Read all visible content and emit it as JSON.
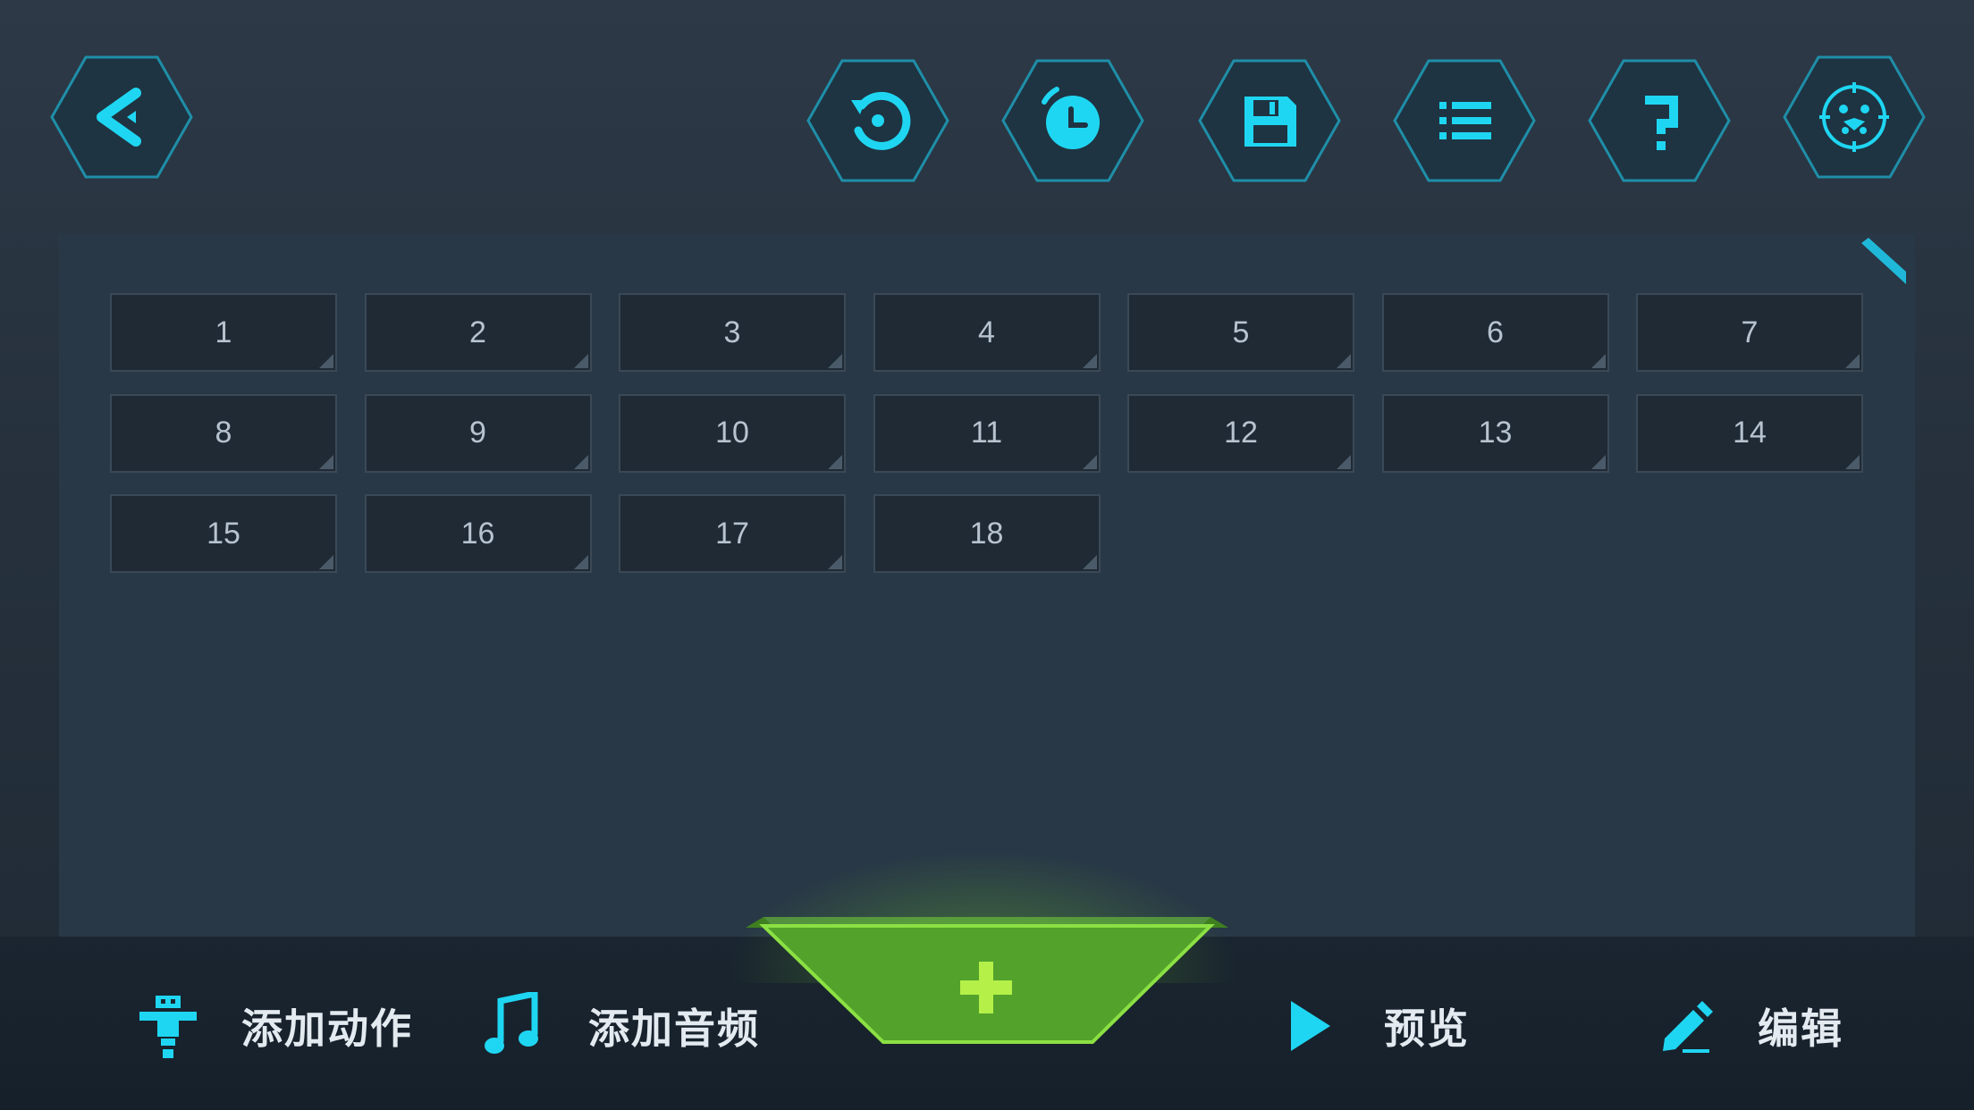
{
  "colors": {
    "accent_cyan": "#1fd6f2",
    "hex_border": "#1f8ea8",
    "hex_fill": "#1e3442",
    "add_green": "#5fb82a",
    "panel_bg": "#283846",
    "cell_bg": "#1f2a34"
  },
  "toolbar": {
    "back_icon": "back-arrow-icon",
    "buttons": [
      {
        "icon": "reset-icon"
      },
      {
        "icon": "timer-icon"
      },
      {
        "icon": "save-icon"
      },
      {
        "icon": "list-icon"
      },
      {
        "icon": "help-icon"
      },
      {
        "icon": "robot-settings-icon"
      }
    ]
  },
  "grid": {
    "cells": [
      "1",
      "2",
      "3",
      "4",
      "5",
      "6",
      "7",
      "8",
      "9",
      "10",
      "11",
      "12",
      "13",
      "14",
      "15",
      "16",
      "17",
      "18"
    ]
  },
  "bottom": {
    "add_action_label": "添加动作",
    "add_audio_label": "添加音频",
    "add_button_icon": "plus-icon",
    "preview_label": "预览",
    "edit_label": "编辑"
  }
}
